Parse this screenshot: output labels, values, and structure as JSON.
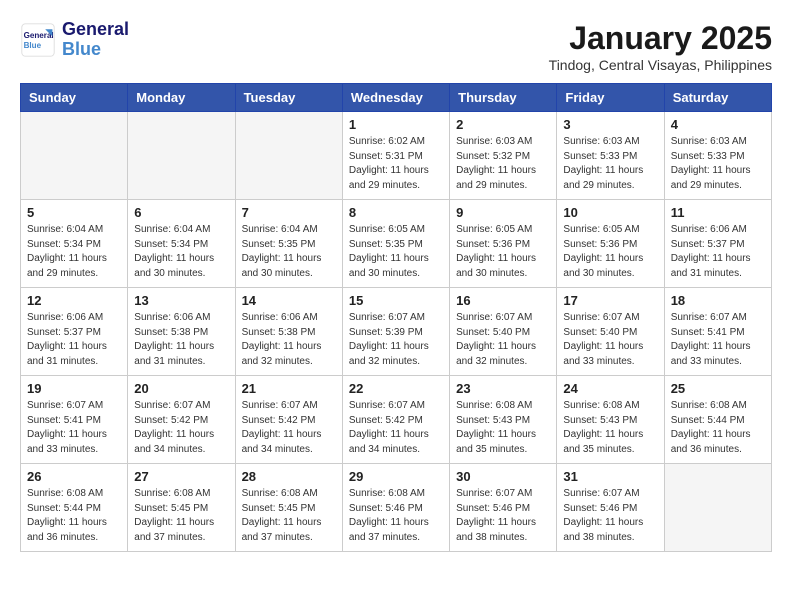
{
  "logo": {
    "line1": "General",
    "line2": "Blue"
  },
  "title": "January 2025",
  "location": "Tindog, Central Visayas, Philippines",
  "weekdays": [
    "Sunday",
    "Monday",
    "Tuesday",
    "Wednesday",
    "Thursday",
    "Friday",
    "Saturday"
  ],
  "weeks": [
    [
      {
        "day": "",
        "info": ""
      },
      {
        "day": "",
        "info": ""
      },
      {
        "day": "",
        "info": ""
      },
      {
        "day": "1",
        "info": "Sunrise: 6:02 AM\nSunset: 5:31 PM\nDaylight: 11 hours and 29 minutes."
      },
      {
        "day": "2",
        "info": "Sunrise: 6:03 AM\nSunset: 5:32 PM\nDaylight: 11 hours and 29 minutes."
      },
      {
        "day": "3",
        "info": "Sunrise: 6:03 AM\nSunset: 5:33 PM\nDaylight: 11 hours and 29 minutes."
      },
      {
        "day": "4",
        "info": "Sunrise: 6:03 AM\nSunset: 5:33 PM\nDaylight: 11 hours and 29 minutes."
      }
    ],
    [
      {
        "day": "5",
        "info": "Sunrise: 6:04 AM\nSunset: 5:34 PM\nDaylight: 11 hours and 29 minutes."
      },
      {
        "day": "6",
        "info": "Sunrise: 6:04 AM\nSunset: 5:34 PM\nDaylight: 11 hours and 30 minutes."
      },
      {
        "day": "7",
        "info": "Sunrise: 6:04 AM\nSunset: 5:35 PM\nDaylight: 11 hours and 30 minutes."
      },
      {
        "day": "8",
        "info": "Sunrise: 6:05 AM\nSunset: 5:35 PM\nDaylight: 11 hours and 30 minutes."
      },
      {
        "day": "9",
        "info": "Sunrise: 6:05 AM\nSunset: 5:36 PM\nDaylight: 11 hours and 30 minutes."
      },
      {
        "day": "10",
        "info": "Sunrise: 6:05 AM\nSunset: 5:36 PM\nDaylight: 11 hours and 30 minutes."
      },
      {
        "day": "11",
        "info": "Sunrise: 6:06 AM\nSunset: 5:37 PM\nDaylight: 11 hours and 31 minutes."
      }
    ],
    [
      {
        "day": "12",
        "info": "Sunrise: 6:06 AM\nSunset: 5:37 PM\nDaylight: 11 hours and 31 minutes."
      },
      {
        "day": "13",
        "info": "Sunrise: 6:06 AM\nSunset: 5:38 PM\nDaylight: 11 hours and 31 minutes."
      },
      {
        "day": "14",
        "info": "Sunrise: 6:06 AM\nSunset: 5:38 PM\nDaylight: 11 hours and 32 minutes."
      },
      {
        "day": "15",
        "info": "Sunrise: 6:07 AM\nSunset: 5:39 PM\nDaylight: 11 hours and 32 minutes."
      },
      {
        "day": "16",
        "info": "Sunrise: 6:07 AM\nSunset: 5:40 PM\nDaylight: 11 hours and 32 minutes."
      },
      {
        "day": "17",
        "info": "Sunrise: 6:07 AM\nSunset: 5:40 PM\nDaylight: 11 hours and 33 minutes."
      },
      {
        "day": "18",
        "info": "Sunrise: 6:07 AM\nSunset: 5:41 PM\nDaylight: 11 hours and 33 minutes."
      }
    ],
    [
      {
        "day": "19",
        "info": "Sunrise: 6:07 AM\nSunset: 5:41 PM\nDaylight: 11 hours and 33 minutes."
      },
      {
        "day": "20",
        "info": "Sunrise: 6:07 AM\nSunset: 5:42 PM\nDaylight: 11 hours and 34 minutes."
      },
      {
        "day": "21",
        "info": "Sunrise: 6:07 AM\nSunset: 5:42 PM\nDaylight: 11 hours and 34 minutes."
      },
      {
        "day": "22",
        "info": "Sunrise: 6:07 AM\nSunset: 5:42 PM\nDaylight: 11 hours and 34 minutes."
      },
      {
        "day": "23",
        "info": "Sunrise: 6:08 AM\nSunset: 5:43 PM\nDaylight: 11 hours and 35 minutes."
      },
      {
        "day": "24",
        "info": "Sunrise: 6:08 AM\nSunset: 5:43 PM\nDaylight: 11 hours and 35 minutes."
      },
      {
        "day": "25",
        "info": "Sunrise: 6:08 AM\nSunset: 5:44 PM\nDaylight: 11 hours and 36 minutes."
      }
    ],
    [
      {
        "day": "26",
        "info": "Sunrise: 6:08 AM\nSunset: 5:44 PM\nDaylight: 11 hours and 36 minutes."
      },
      {
        "day": "27",
        "info": "Sunrise: 6:08 AM\nSunset: 5:45 PM\nDaylight: 11 hours and 37 minutes."
      },
      {
        "day": "28",
        "info": "Sunrise: 6:08 AM\nSunset: 5:45 PM\nDaylight: 11 hours and 37 minutes."
      },
      {
        "day": "29",
        "info": "Sunrise: 6:08 AM\nSunset: 5:46 PM\nDaylight: 11 hours and 37 minutes."
      },
      {
        "day": "30",
        "info": "Sunrise: 6:07 AM\nSunset: 5:46 PM\nDaylight: 11 hours and 38 minutes."
      },
      {
        "day": "31",
        "info": "Sunrise: 6:07 AM\nSunset: 5:46 PM\nDaylight: 11 hours and 38 minutes."
      },
      {
        "day": "",
        "info": ""
      }
    ]
  ]
}
